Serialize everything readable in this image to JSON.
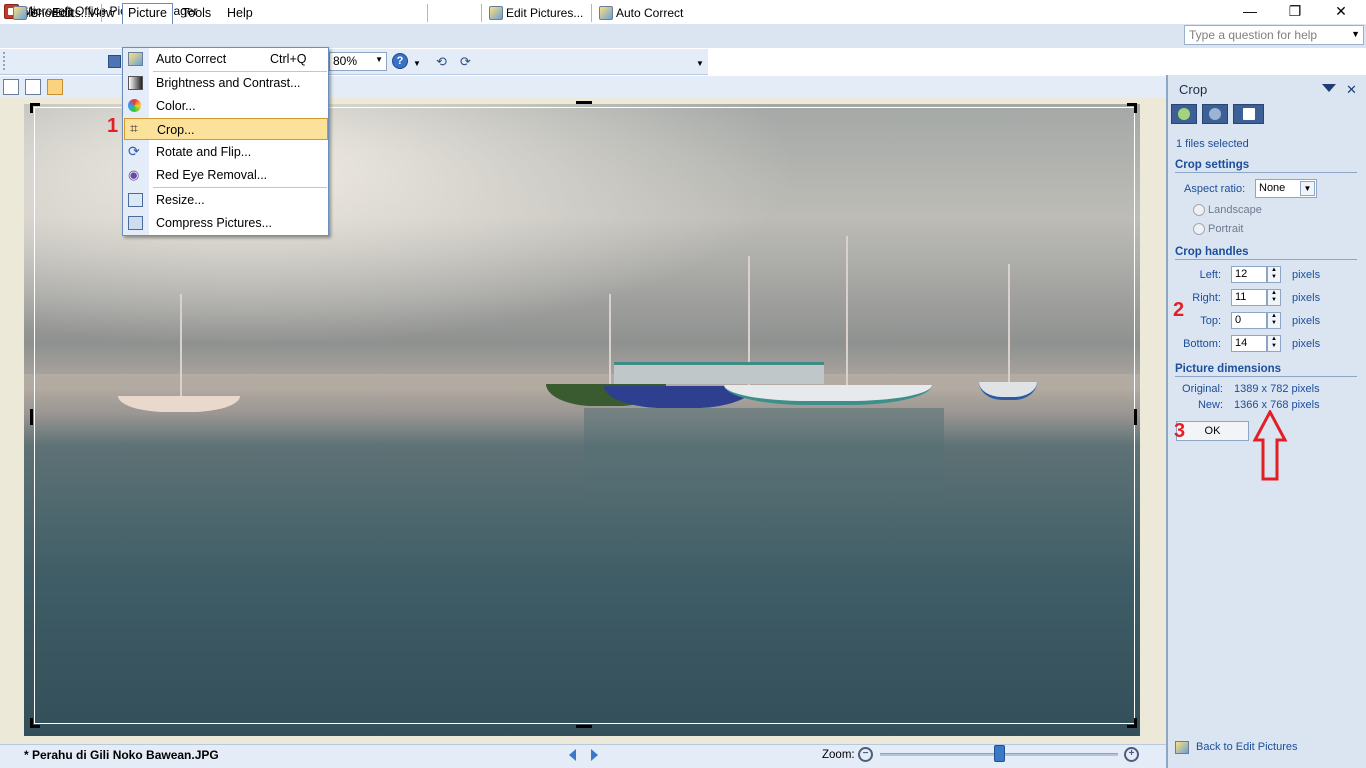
{
  "window": {
    "title": "Microsoft Office Picture Manager",
    "minimize": "—",
    "restore": "❐",
    "close": "✕"
  },
  "menubar": {
    "items": [
      "File",
      "Edit",
      "View",
      "Picture",
      "Tools",
      "Help"
    ],
    "help_placeholder": "Type a question for help"
  },
  "toolbar": {
    "shortcuts_label": "Shortcuts...",
    "zoom_value": "80%",
    "edit_pictures_label": "Edit Pictures...",
    "auto_correct_label": "Auto Correct"
  },
  "picture_menu": {
    "items": [
      {
        "label": "Auto Correct",
        "shortcut": "Ctrl+Q"
      },
      {
        "label": "Brightness and Contrast..."
      },
      {
        "label": "Color..."
      },
      {
        "label": "Crop..."
      },
      {
        "label": "Rotate and Flip..."
      },
      {
        "label": "Red Eye Removal..."
      },
      {
        "label": "Resize..."
      },
      {
        "label": "Compress Pictures..."
      }
    ],
    "highlighted": "Crop..."
  },
  "annotations": {
    "step1": "1",
    "step2": "2",
    "step3": "3"
  },
  "crop_pane": {
    "title": "Crop",
    "files_selected": "1 files selected",
    "crop_settings_heading": "Crop settings",
    "aspect_ratio_label": "Aspect ratio:",
    "aspect_ratio_value": "None",
    "landscape_label": "Landscape",
    "portrait_label": "Portrait",
    "crop_handles_heading": "Crop handles",
    "handles": [
      {
        "label": "Left:",
        "value": "12",
        "unit": "pixels"
      },
      {
        "label": "Right:",
        "value": "11",
        "unit": "pixels"
      },
      {
        "label": "Top:",
        "value": "0",
        "unit": "pixels"
      },
      {
        "label": "Bottom:",
        "value": "14",
        "unit": "pixels"
      }
    ],
    "dimensions_heading": "Picture dimensions",
    "original_label": "Original:",
    "original_value": "1389 x 782 pixels",
    "new_label": "New:",
    "new_value": "1366 x 768 pixels",
    "ok_label": "OK",
    "back_link": "Back to Edit Pictures"
  },
  "statusbar": {
    "filename": "* Perahu di Gili Noko Bawean.JPG",
    "zoom_label": "Zoom:",
    "zoom_level": 0.5
  },
  "colors": {
    "accent_highlight": "#fbe19a",
    "annotation_red": "#e31f26",
    "pane_text": "#1b4e9b"
  }
}
